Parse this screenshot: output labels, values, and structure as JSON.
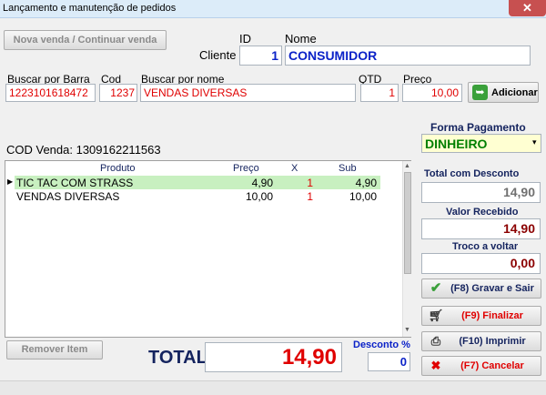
{
  "window": {
    "title": "Lançamento e manutenção de pedidos",
    "close_label": "✕"
  },
  "top": {
    "nova_venda_label": "Nova venda / Continuar venda",
    "cliente_label": "Cliente",
    "id_label": "ID",
    "nome_label": "Nome",
    "cliente_id": "1",
    "cliente_nome": "CONSUMIDOR"
  },
  "search": {
    "barra_label": "Buscar por Barra",
    "barra_value": "1223101618472",
    "cod_label": "Cod",
    "cod_value": "1237",
    "nome_label": "Buscar por nome",
    "nome_value": "VENDAS DIVERSAS",
    "qtd_label": "QTD",
    "qtd_value": "1",
    "preco_label": "Preço",
    "preco_value": "10,00",
    "adicionar_label": "Adicionar"
  },
  "cod_venda": "COD Venda: 1309162211563",
  "grid": {
    "columns": [
      "Produto",
      "Preço",
      "X",
      "Sub"
    ],
    "rows": [
      {
        "produto": "TIC TAC COM STRASS",
        "preco": "4,90",
        "x": "1",
        "sub": "4,90"
      },
      {
        "produto": "VENDAS DIVERSAS",
        "preco": "10,00",
        "x": "1",
        "sub": "10,00"
      }
    ],
    "row_indicator": "▶"
  },
  "bottom": {
    "remover_label": "Remover Item",
    "total_label": "TOTAL",
    "total_value": "14,90",
    "desconto_label": "Desconto %",
    "desconto_value": "0"
  },
  "side": {
    "forma_label": "Forma Pagamento",
    "forma_value": "DINHEIRO",
    "total_desc_label": "Total com Desconto",
    "total_desc_value": "14,90",
    "valor_rec_label": "Valor Recebido",
    "valor_rec_value": "14,90",
    "troco_label": "Troco a voltar",
    "troco_value": "0,00",
    "gravar_label": "(F8) Gravar e Sair",
    "finalizar_label": "(F9) Finalizar",
    "imprimir_label": "(F10) Imprimir",
    "cancelar_label": "(F7) Cancelar"
  },
  "colors": {
    "accent_blue": "#0b22c8",
    "red": "#e00000",
    "selected_row": "#c8f0c0",
    "payment_bg": "#ffffd2",
    "payment_text": "#007f00",
    "dark_red": "#8b0000",
    "navy": "#14235e"
  }
}
